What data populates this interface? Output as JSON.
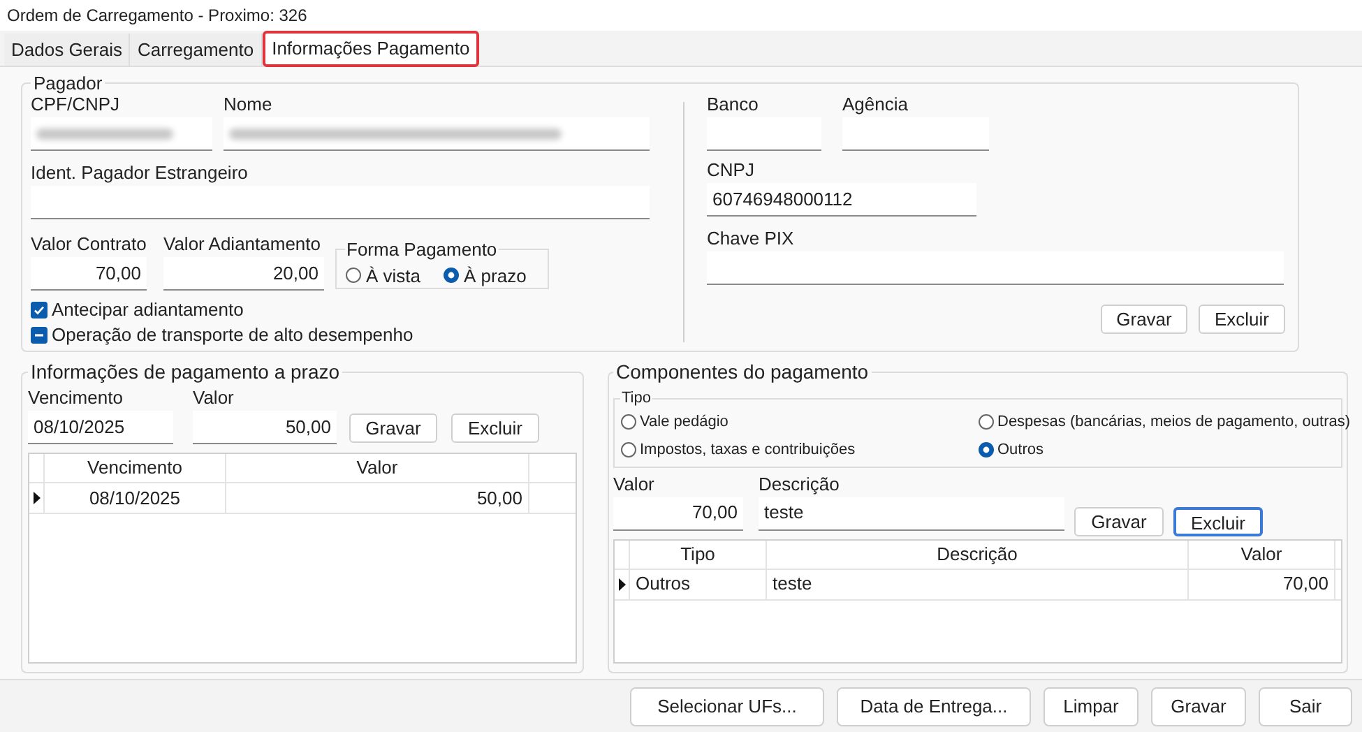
{
  "window": {
    "title": "Ordem de Carregamento - Proximo: 326"
  },
  "tabs": [
    {
      "label": "Dados Gerais",
      "selected": false
    },
    {
      "label": "Carregamento",
      "selected": false
    },
    {
      "label": "Informações Pagamento",
      "selected": true
    }
  ],
  "pagador": {
    "title": "Pagador",
    "cpf_cnpj": {
      "label": "CPF/CNPJ",
      "redacted": true
    },
    "nome": {
      "label": "Nome",
      "redacted": true
    },
    "ident_estrangeiro": {
      "label": "Ident. Pagador Estrangeiro"
    },
    "valor_contrato": {
      "label": "Valor Contrato",
      "value": "70,00"
    },
    "valor_adiantamento": {
      "label": "Valor Adiantamento",
      "value": "20,00"
    },
    "forma_pagamento": {
      "title": "Forma Pagamento",
      "options": [
        {
          "label": "À vista",
          "selected": false
        },
        {
          "label": "À prazo",
          "selected": true
        }
      ]
    },
    "checkboxes": [
      {
        "label": "Antecipar adiantamento",
        "checked": true,
        "indeterminate": false
      },
      {
        "label": "Operação de transporte de alto desempenho",
        "checked": false,
        "indeterminate": true
      }
    ]
  },
  "conta": {
    "banco": {
      "label": "Banco"
    },
    "agencia": {
      "label": "Agência"
    },
    "cnpj": {
      "label": "CNPJ",
      "value": "60746948000112"
    },
    "chave_pix": {
      "label": "Chave PIX"
    },
    "buttons": [
      {
        "label": "Gravar",
        "focused": false
      },
      {
        "label": "Excluir",
        "focused": false
      }
    ]
  },
  "pagamento_prazo": {
    "title": "Informações de pagamento a prazo",
    "vencimento": {
      "label": "Vencimento",
      "value": "08/10/2025"
    },
    "valor": {
      "label": "Valor",
      "value": "50,00"
    },
    "buttons": [
      {
        "label": "Gravar",
        "focused": false
      },
      {
        "label": "Excluir",
        "focused": false
      }
    ],
    "table": {
      "columns": [
        "Vencimento",
        "Valor"
      ],
      "rows": [
        {
          "current": true,
          "cells": [
            "08/10/2025",
            "50,00"
          ]
        }
      ]
    }
  },
  "componentes": {
    "title": "Componentes do pagamento",
    "tipo": {
      "title": "Tipo",
      "options": [
        {
          "label": "Vale pedágio",
          "selected": false
        },
        {
          "label": "Despesas (bancárias, meios de pagamento, outras)",
          "selected": false
        },
        {
          "label": "Impostos, taxas e contribuições",
          "selected": false
        },
        {
          "label": "Outros",
          "selected": true
        }
      ]
    },
    "valor": {
      "label": "Valor",
      "value": "70,00"
    },
    "descricao": {
      "label": "Descrição",
      "value": "teste"
    },
    "buttons": [
      {
        "label": "Gravar",
        "focused": false
      },
      {
        "label": "Excluir",
        "focused": true
      }
    ],
    "table": {
      "columns": [
        "Tipo",
        "Descrição",
        "Valor"
      ],
      "rows": [
        {
          "current": true,
          "cells": [
            "Outros",
            "teste",
            "70,00"
          ]
        }
      ]
    }
  },
  "footer_buttons": [
    {
      "label": "Selecionar UFs..."
    },
    {
      "label": "Data de Entrega..."
    },
    {
      "label": "Limpar"
    },
    {
      "label": "Gravar"
    },
    {
      "label": "Sair"
    }
  ]
}
